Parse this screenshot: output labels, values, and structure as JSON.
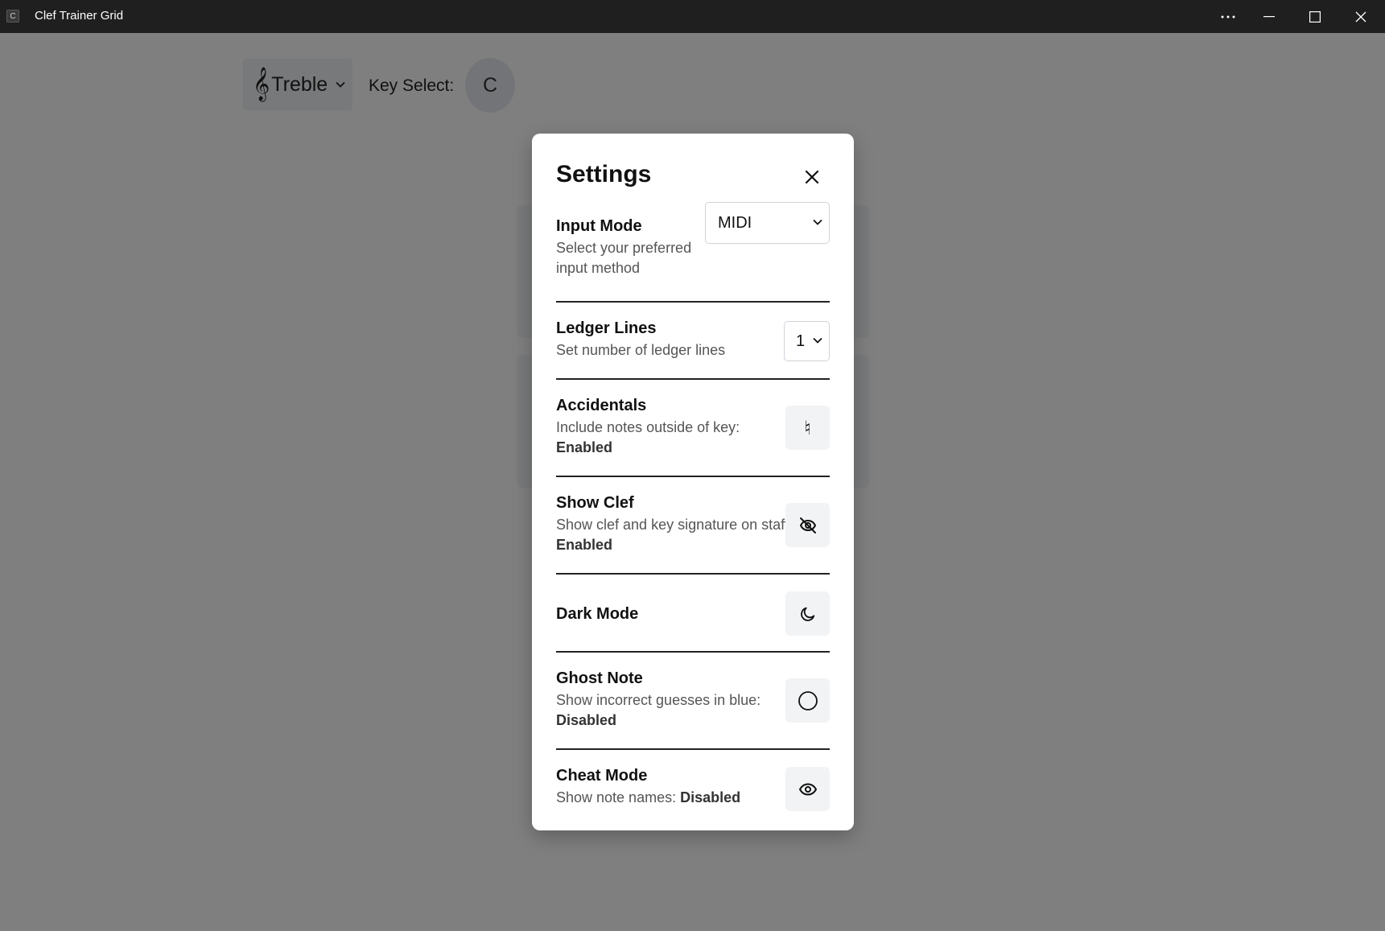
{
  "window": {
    "title": "Clef Trainer Grid",
    "icon_letter": "C"
  },
  "toolbar": {
    "clef_glyph": "𝄞",
    "clef_value": "Treble",
    "key_label": "Key Select:",
    "key_value": "C"
  },
  "settings": {
    "title": "Settings",
    "input_mode": {
      "title": "Input Mode",
      "desc_line1": "Select your preferred",
      "desc_line2": "input method",
      "value": "MIDI"
    },
    "ledger_lines": {
      "title": "Ledger Lines",
      "desc": "Set number of ledger lines",
      "value": "1"
    },
    "accidentals": {
      "title": "Accidentals",
      "desc": "Include notes outside of key:",
      "status": "Enabled",
      "icon_glyph": "♮"
    },
    "show_clef": {
      "title": "Show Clef",
      "desc": "Show clef and key signature on staff:",
      "status": "Enabled"
    },
    "dark_mode": {
      "title": "Dark Mode"
    },
    "ghost_note": {
      "title": "Ghost Note",
      "desc": "Show incorrect guesses in blue:",
      "status": "Disabled"
    },
    "cheat_mode": {
      "title": "Cheat Mode",
      "desc": "Show note names: ",
      "status": "Disabled"
    }
  },
  "icons": {
    "close": "close-icon",
    "accidentals": "natural-icon",
    "show_clef": "eye-off-icon",
    "dark_mode": "moon-icon",
    "ghost_note": "circle-icon",
    "cheat_mode": "eye-icon"
  }
}
